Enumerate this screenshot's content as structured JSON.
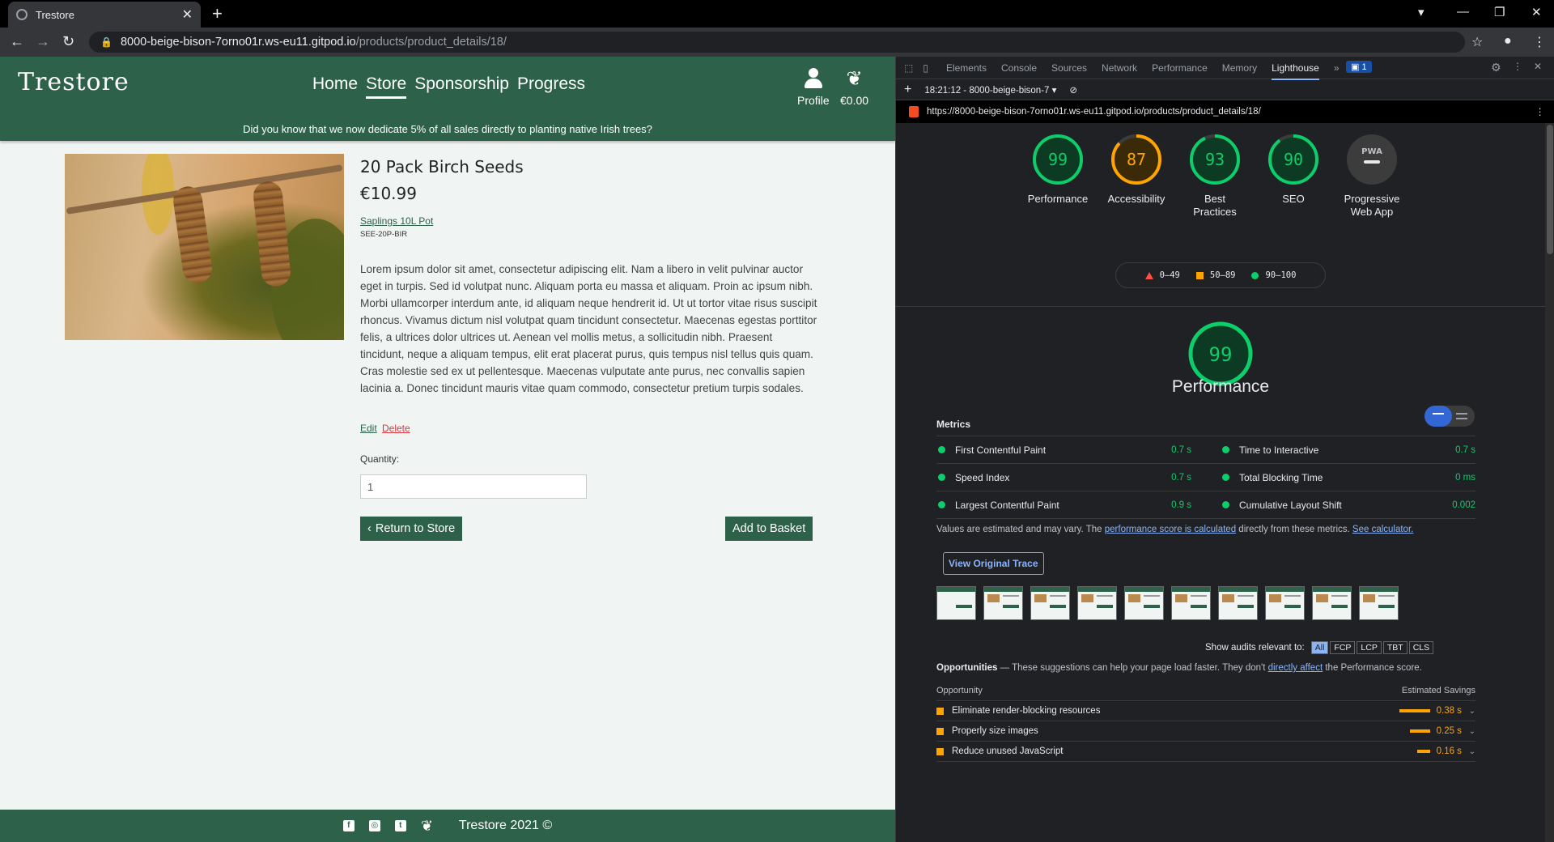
{
  "browser": {
    "tab_title": "Trestore",
    "url_host": "8000-beige-bison-7orno01r.ws-eu11.gitpod.io",
    "url_path": "/products/product_details/18/"
  },
  "site": {
    "logo": "Trestore",
    "nav": [
      {
        "label": "Home"
      },
      {
        "label": "Store"
      },
      {
        "label": "Sponsorship"
      },
      {
        "label": "Progress"
      }
    ],
    "profile_label": "Profile",
    "basket_total": "€0.00",
    "banner": "Did you know that we now dedicate 5% of all sales directly to planting native Irish trees?",
    "footer_text": "Trestore  2021 ©"
  },
  "product": {
    "title": "20 Pack Birch Seeds",
    "price": "€10.99",
    "category": "Saplings 10L Pot",
    "sku": "SEE-20P-BIR",
    "description": "Lorem ipsum dolor sit amet, consectetur adipiscing elit. Nam a libero in velit pulvinar auctor eget in turpis. Sed id volutpat nunc. Aliquam porta eu massa et aliquam. Proin ac ipsum nibh. Morbi ullamcorper interdum ante, id aliquam neque hendrerit id. Ut ut tortor vitae risus suscipit rhoncus. Vivamus dictum nisl volutpat quam tincidunt consectetur. Maecenas egestas porttitor felis, a ultrices dolor ultrices ut. Aenean vel mollis metus, a sollicitudin nibh. Praesent tincidunt, neque a aliquam tempus, elit erat placerat purus, quis tempus nisl tellus quis quam. Cras molestie sed ex ut pellentesque. Maecenas vulputate ante purus, nec convallis sapien lacinia a. Donec tincidunt mauris vitae quam commodo, consectetur pretium turpis sodales.",
    "edit_label": "Edit",
    "delete_label": "Delete",
    "quantity_label": "Quantity:",
    "quantity_value": "1",
    "return_label": "Return to Store",
    "add_label": "Add to Basket"
  },
  "devtools": {
    "tabs": [
      "Elements",
      "Console",
      "Sources",
      "Network",
      "Performance",
      "Memory",
      "Lighthouse"
    ],
    "active_tab": "Lighthouse",
    "issues_count": "1",
    "report_selector": "18:21:12 - 8000-beige-bison-7",
    "report_url": "https://8000-beige-bison-7orno01r.ws-eu11.gitpod.io/products/product_details/18/"
  },
  "lighthouse": {
    "colors": {
      "pass": "#0cce6b",
      "average": "#ffa400",
      "fail": "#ff4e42"
    },
    "scores": [
      {
        "label": "Performance",
        "score": 99,
        "color": "#0cce6b"
      },
      {
        "label": "Accessibility",
        "score": 87,
        "color": "#ffa400"
      },
      {
        "label": "Best Practices",
        "score": 93,
        "color": "#0cce6b"
      },
      {
        "label": "SEO",
        "score": 90,
        "color": "#0cce6b"
      },
      {
        "label": "Progressive Web App",
        "score": null,
        "badge": "PWA"
      }
    ],
    "legend": {
      "fail": "0–49",
      "average": "50–89",
      "pass": "90–100"
    },
    "perf_score": "99",
    "perf_title": "Performance",
    "metrics_heading": "Metrics",
    "metrics": [
      {
        "name": "First Contentful Paint",
        "value": "0.7 s"
      },
      {
        "name": "Time to Interactive",
        "value": "0.7 s"
      },
      {
        "name": "Speed Index",
        "value": "0.7 s"
      },
      {
        "name": "Total Blocking Time",
        "value": "0 ms"
      },
      {
        "name": "Largest Contentful Paint",
        "value": "0.9 s"
      },
      {
        "name": "Cumulative Layout Shift",
        "value": "0.002"
      }
    ],
    "note_prefix": "Values are estimated and may vary. The ",
    "note_link1": "performance score is calculated",
    "note_mid": " directly from these metrics. ",
    "note_link2": "See calculator.",
    "trace_button": "View Original Trace",
    "show_audits_label": "Show audits relevant to:",
    "audit_chips": [
      "All",
      "FCP",
      "LCP",
      "TBT",
      "CLS"
    ],
    "opps_title": "Opportunities",
    "opps_text": " — These suggestions can help your page load faster. They don't ",
    "opps_link": "directly affect",
    "opps_tail": " the Performance score.",
    "opp_col1": "Opportunity",
    "opp_col2": "Estimated Savings",
    "opportunities": [
      {
        "name": "Eliminate render-blocking resources",
        "savings": "0.38 s",
        "bar": 0.38
      },
      {
        "name": "Properly size images",
        "savings": "0.25 s",
        "bar": 0.25
      },
      {
        "name": "Reduce unused JavaScript",
        "savings": "0.16 s",
        "bar": 0.16
      }
    ]
  }
}
